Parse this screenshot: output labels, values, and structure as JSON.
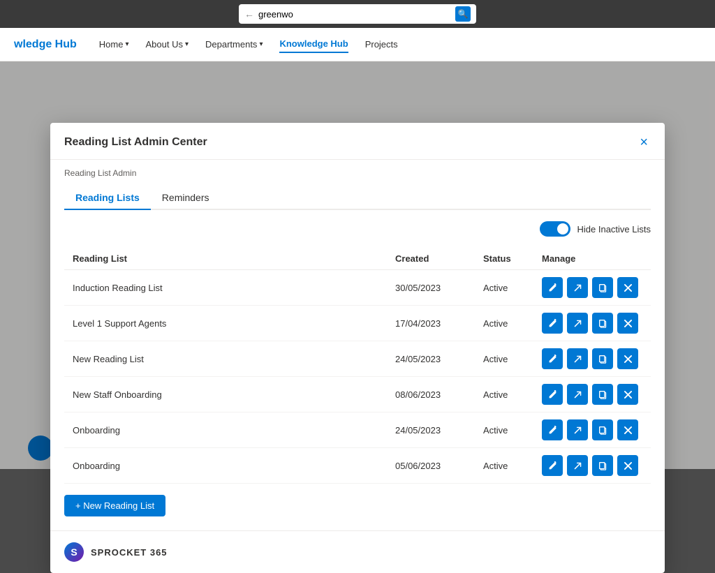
{
  "browser": {
    "address": "greenwo",
    "search_icon": "🔍"
  },
  "nav": {
    "logo": "wledge Hub",
    "items": [
      {
        "label": "Home",
        "has_arrow": true,
        "active": false
      },
      {
        "label": "About Us",
        "has_arrow": true,
        "active": false
      },
      {
        "label": "Departments",
        "has_arrow": true,
        "active": false
      },
      {
        "label": "Knowledge Hub",
        "has_arrow": false,
        "active": true
      },
      {
        "label": "Projects",
        "has_arrow": false,
        "active": false
      }
    ]
  },
  "modal": {
    "title": "Reading List Admin Center",
    "close_label": "×",
    "breadcrumb": "Reading List Admin",
    "tabs": [
      {
        "label": "Reading Lists",
        "active": true
      },
      {
        "label": "Reminders",
        "active": false
      }
    ],
    "toggle": {
      "label": "Hide Inactive Lists"
    },
    "table": {
      "headers": [
        "Reading List",
        "Created",
        "Status",
        "Manage"
      ],
      "rows": [
        {
          "name": "Induction Reading List",
          "created": "30/05/2023",
          "status": "Active"
        },
        {
          "name": "Level 1 Support Agents",
          "created": "17/04/2023",
          "status": "Active"
        },
        {
          "name": "New Reading List",
          "created": "24/05/2023",
          "status": "Active"
        },
        {
          "name": "New Staff Onboarding",
          "created": "08/06/2023",
          "status": "Active"
        },
        {
          "name": "Onboarding",
          "created": "24/05/2023",
          "status": "Active"
        },
        {
          "name": "Onboarding",
          "created": "05/06/2023",
          "status": "Active"
        }
      ],
      "actions": [
        {
          "icon": "✏️",
          "title": "Edit"
        },
        {
          "icon": "↗",
          "title": "Navigate"
        },
        {
          "icon": "⧉",
          "title": "Copy"
        },
        {
          "icon": "✕",
          "title": "Delete"
        }
      ]
    },
    "new_list_btn": "+ New Reading List",
    "footer": {
      "brand": "SPROCKET 365"
    }
  }
}
